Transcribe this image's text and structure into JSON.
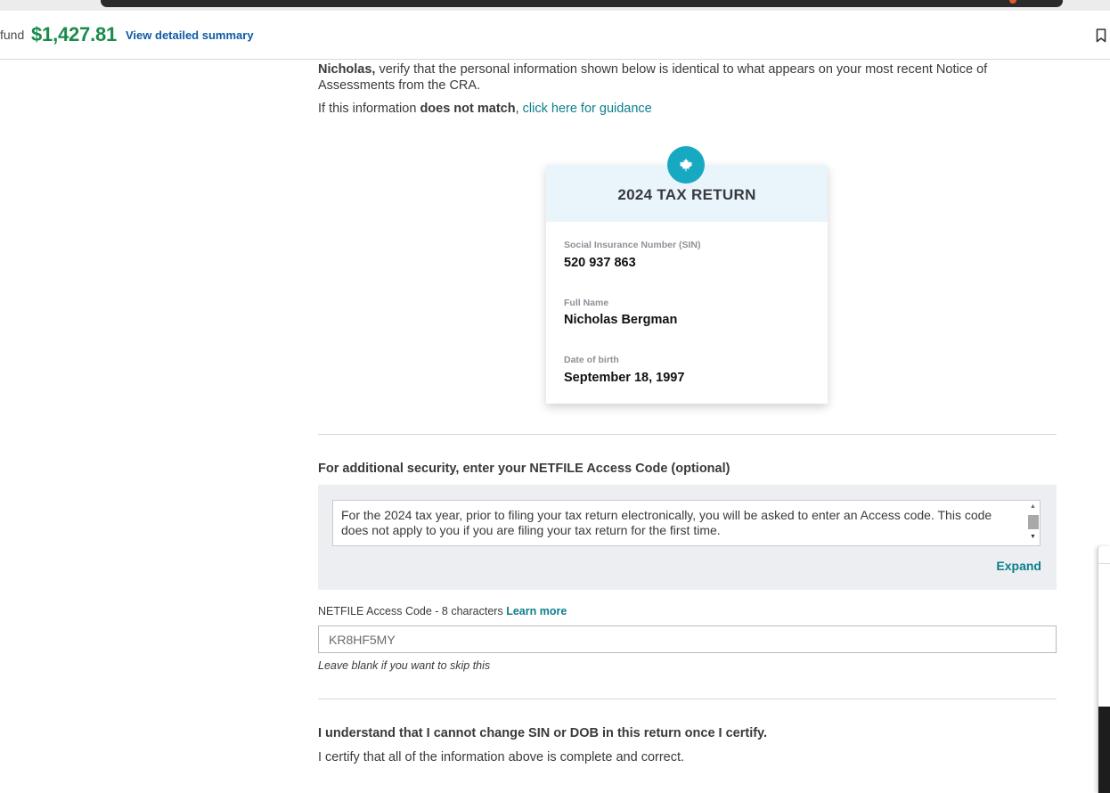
{
  "header": {
    "refund_label": "fund",
    "refund_amount": "$1,427.81",
    "summary_link": "View detailed summary"
  },
  "intro": {
    "name": "Nicholas,",
    "text": " verify that the personal information shown below is identical to what appears on your most recent Notice of Assessments from the CRA.",
    "mismatch_prefix": "If this information ",
    "mismatch_bold": "does not match",
    "mismatch_comma": ", ",
    "guidance_link": "click here for guidance"
  },
  "card": {
    "title": "2024 TAX RETURN",
    "sin_label": "Social Insurance Number (SIN)",
    "sin_value": "520 937 863",
    "name_label": "Full Name",
    "name_value": "Nicholas Bergman",
    "dob_label": "Date of birth",
    "dob_value": "September 18, 1997"
  },
  "netfile": {
    "heading": "For additional security, enter your NETFILE Access Code (optional)",
    "info_text": "For the 2024 tax year, prior to filing your tax return electronically, you will be asked to enter an Access code. This code does not apply to you if you are filing your tax return for the first time.",
    "expand": "Expand",
    "code_label": "NETFILE Access Code - 8 characters ",
    "learn_more": "Learn more",
    "code_value": "KR8HF5MY",
    "hint": "Leave blank if you want to skip this"
  },
  "certify": {
    "heading": "I understand that I cannot change SIN or DOB in this return once I certify.",
    "text": "I certify that all of the information above is complete and correct."
  },
  "colors": {
    "accent": "#0d7f8c",
    "refund_green": "#1a8b4c",
    "badge": "#18a9c2"
  }
}
